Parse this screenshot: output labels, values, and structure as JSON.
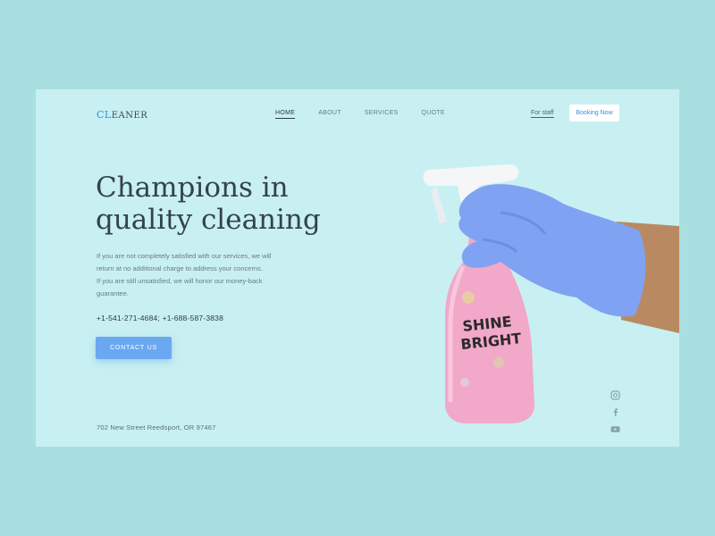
{
  "brand": {
    "logo_prefix": "CL",
    "logo_suffix": "EANER"
  },
  "nav": {
    "items": [
      {
        "label": "HOME",
        "active": true
      },
      {
        "label": "ABOUT",
        "active": false
      },
      {
        "label": "SERVICES",
        "active": false
      },
      {
        "label": "QUOTE",
        "active": false
      }
    ],
    "staff_link": "For staff",
    "booking_button": "Booking Now"
  },
  "hero": {
    "headline_line1": "Champions in",
    "headline_line2": "quality cleaning",
    "description_line1": "If you are not completely satisfied with our services, we will",
    "description_line2": "return at no additional charge to address your concerns.",
    "description_line3": "If you are still unsatisfied, we will honor our money-back",
    "description_line4": "guarantee.",
    "phones": "+1-541-271-4684; +1-688-587-3838",
    "contact_button": "CONTACT US"
  },
  "product": {
    "label_line1": "SHINE",
    "label_line2": "BRIGHT"
  },
  "footer": {
    "address": "702 New Street Reedsport, OR 97467"
  },
  "social": [
    "instagram-icon",
    "facebook-icon",
    "youtube-icon"
  ],
  "colors": {
    "background": "#a9dfe1",
    "card": "#c8f0f2",
    "accent": "#6aa8f2",
    "heading": "#33424e",
    "glove": "#7ea0f0",
    "bottle": "#f2a4c8"
  }
}
